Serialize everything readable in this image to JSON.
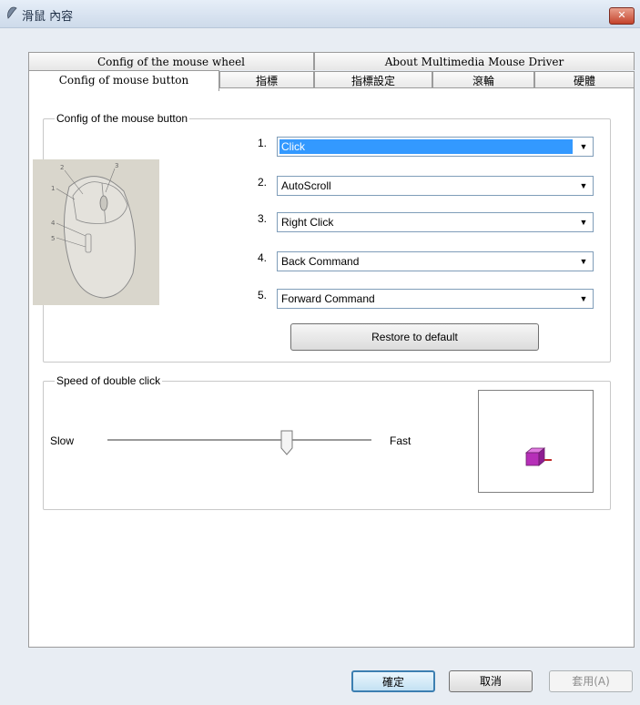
{
  "window": {
    "title": "滑鼠 內容",
    "close_icon": "close-x-icon"
  },
  "tabs_row1": [
    {
      "label": "Config of the mouse wheel"
    },
    {
      "label": "About Multimedia Mouse Driver"
    }
  ],
  "tabs_row2": [
    {
      "label": "Config of mouse button",
      "active": true
    },
    {
      "label": "指標"
    },
    {
      "label": "指標設定"
    },
    {
      "label": "滾輪"
    },
    {
      "label": "硬體"
    }
  ],
  "buttons_group": {
    "legend": "Config of the mouse button",
    "image_labels": [
      "1",
      "2",
      "3",
      "4",
      "5"
    ],
    "rows": [
      {
        "num": "1.",
        "value": "Click"
      },
      {
        "num": "2.",
        "value": "AutoScroll"
      },
      {
        "num": "3.",
        "value": "Right Click"
      },
      {
        "num": "4.",
        "value": "Back Command"
      },
      {
        "num": "5.",
        "value": "Forward Command"
      }
    ],
    "restore_label": "Restore to default"
  },
  "speed_group": {
    "legend": "Speed of double click",
    "slow_label": "Slow",
    "fast_label": "Fast",
    "slider_value": 0.68
  },
  "footer": {
    "ok": "確定",
    "cancel": "取消",
    "apply": "套用(A)"
  },
  "colors": {
    "selection": "#3399ff",
    "preview_box": "#b62fb8"
  }
}
